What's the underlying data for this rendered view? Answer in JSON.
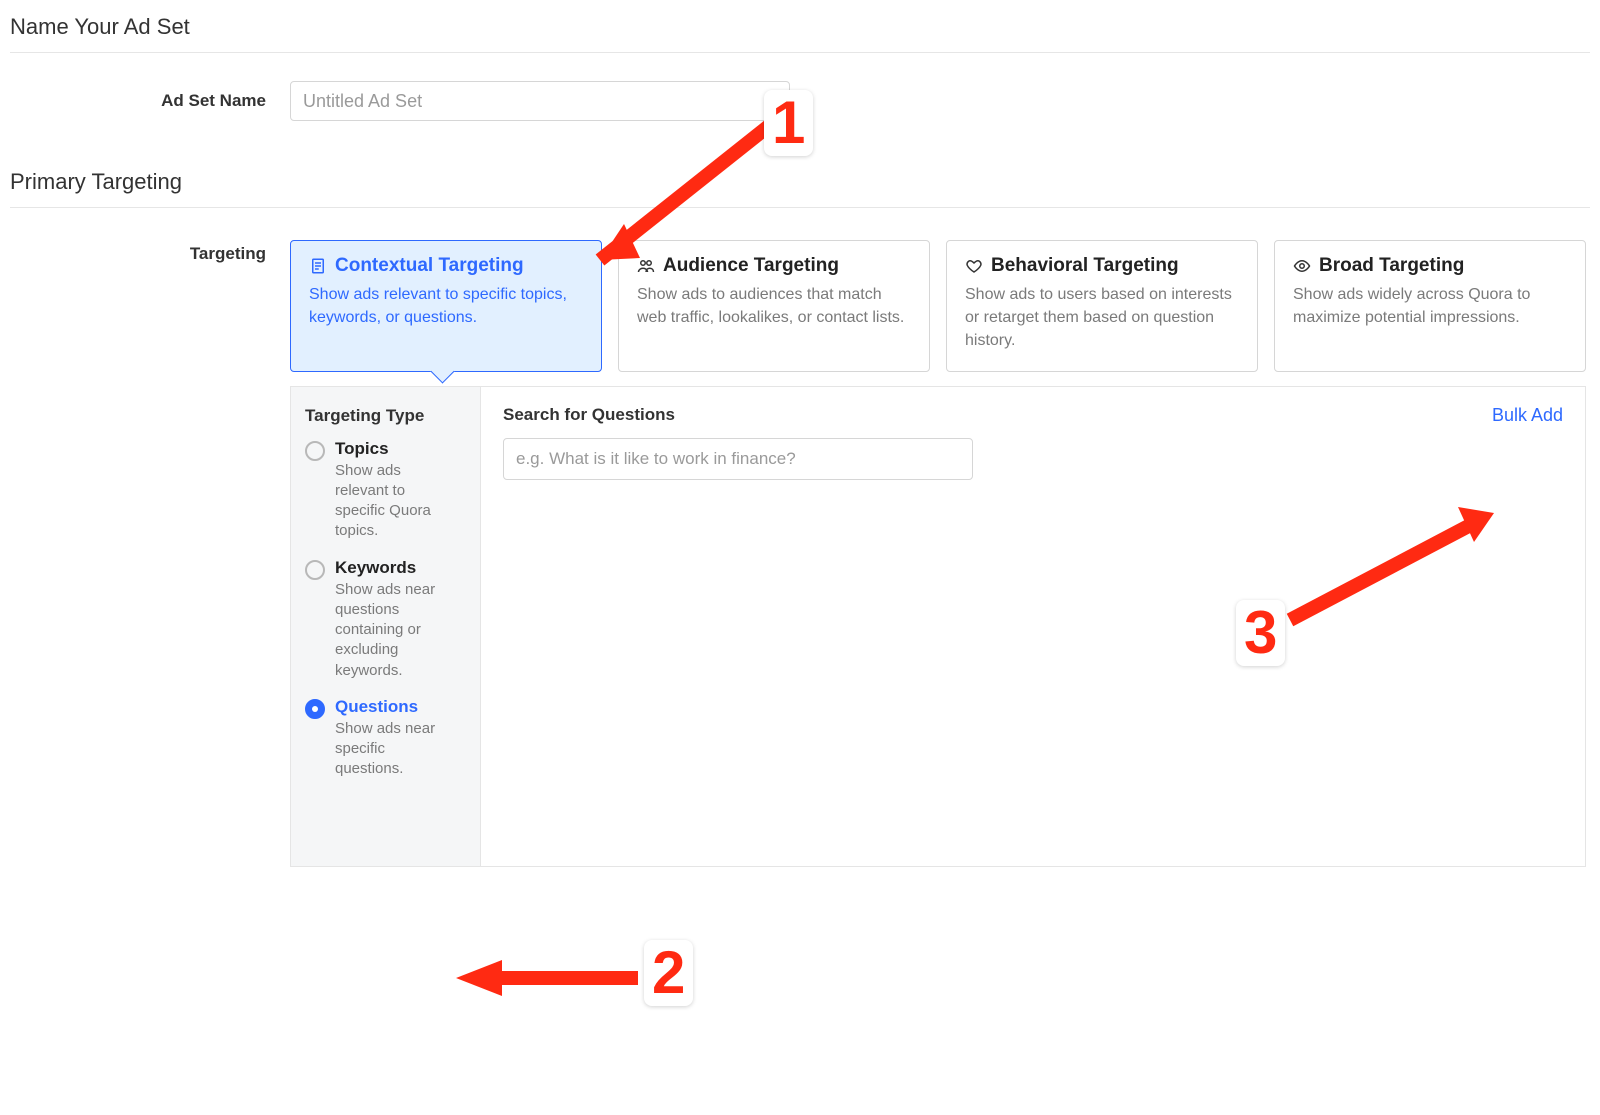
{
  "section_name_title": "Name Your Ad Set",
  "adset_name_label": "Ad Set Name",
  "adset_name": {
    "value": "",
    "placeholder": "Untitled Ad Set"
  },
  "section_targeting_title": "Primary Targeting",
  "targeting_label": "Targeting",
  "cards": [
    {
      "title": "Contextual Targeting",
      "desc": "Show ads relevant to specific topics, keywords, or questions.",
      "selected": true
    },
    {
      "title": "Audience Targeting",
      "desc": "Show ads to audiences that match web traffic, lookalikes, or contact lists.",
      "selected": false
    },
    {
      "title": "Behavioral Targeting",
      "desc": "Show ads to users based on interests or retarget them based on question history.",
      "selected": false
    },
    {
      "title": "Broad Targeting",
      "desc": "Show ads widely across Quora to maximize potential impressions.",
      "selected": false
    }
  ],
  "targeting_type_label": "Targeting Type",
  "radios": [
    {
      "title": "Topics",
      "desc": "Show ads relevant to specific Quora topics.",
      "selected": false
    },
    {
      "title": "Keywords",
      "desc": "Show ads near questions containing or excluding keywords.",
      "selected": false
    },
    {
      "title": "Questions",
      "desc": "Show ads near specific questions.",
      "selected": true
    }
  ],
  "search_label": "Search for Questions",
  "search": {
    "value": "",
    "placeholder": "e.g. What is it like to work in finance?"
  },
  "bulk_add_label": "Bulk Add",
  "annotations": {
    "n1": "1",
    "n2": "2",
    "n3": "3"
  }
}
